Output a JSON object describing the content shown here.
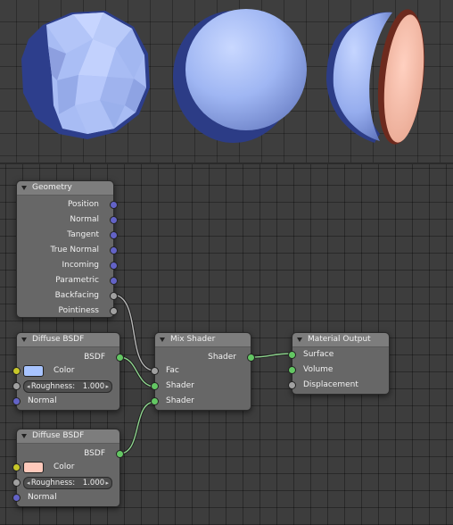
{
  "colors": {
    "socket_vector": "#6363c7",
    "socket_value": "#a1a1a1",
    "socket_color": "#c7c729",
    "socket_shader": "#63c763",
    "diffuse_color_1": "#a8c4ff",
    "diffuse_color_2": "#ffc9bb"
  },
  "preview_objects": [
    "low-poly sphere",
    "smooth sphere",
    "half sphere with pink interior"
  ],
  "nodes": {
    "geometry": {
      "title": "Geometry",
      "outputs": [
        "Position",
        "Normal",
        "Tangent",
        "True Normal",
        "Incoming",
        "Parametric",
        "Backfacing",
        "Pointiness"
      ]
    },
    "diffuse1": {
      "title": "Diffuse BSDF",
      "output": "BSDF",
      "color_label": "Color",
      "roughness_label": "Roughness:",
      "roughness_value": "1.000",
      "normal_label": "Normal"
    },
    "diffuse2": {
      "title": "Diffuse BSDF",
      "output": "BSDF",
      "color_label": "Color",
      "roughness_label": "Roughness:",
      "roughness_value": "1.000",
      "normal_label": "Normal"
    },
    "mix": {
      "title": "Mix Shader",
      "output": "Shader",
      "inputs": [
        "Fac",
        "Shader",
        "Shader"
      ]
    },
    "output": {
      "title": "Material Output",
      "inputs": [
        "Surface",
        "Volume",
        "Displacement"
      ]
    }
  }
}
